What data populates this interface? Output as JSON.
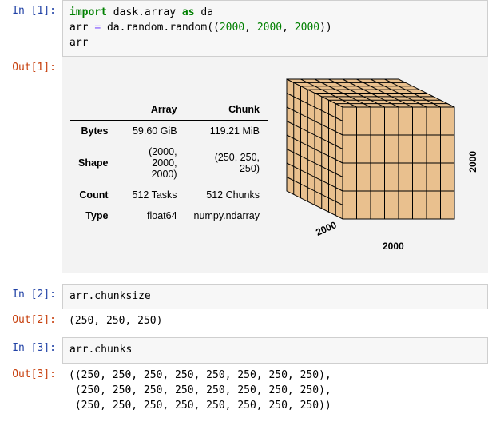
{
  "cells": {
    "in1": {
      "prompt": "In [1]:",
      "code": {
        "kw_import": "import",
        "mod": " dask.array ",
        "kw_as": "as",
        "alias": " da",
        "line2_a": "arr ",
        "line2_eq": "=",
        "line2_b": " da.random.random((",
        "n1": "2000",
        "sep1": ", ",
        "n2": "2000",
        "sep2": ", ",
        "n3": "2000",
        "line2_c": "))",
        "line3": "arr"
      }
    },
    "out1": {
      "prompt": "Out[1]:",
      "table": {
        "col_array": "Array",
        "col_chunk": "Chunk",
        "rows": {
          "bytes": {
            "label": "Bytes",
            "array": "59.60 GiB",
            "chunk": "119.21 MiB"
          },
          "shape": {
            "label": "Shape",
            "array": "(2000, 2000, 2000)",
            "chunk": "(250, 250, 250)"
          },
          "count": {
            "label": "Count",
            "array": "512 Tasks",
            "chunk": "512 Chunks"
          },
          "type": {
            "label": "Type",
            "array": "float64",
            "chunk": "numpy.ndarray"
          }
        }
      },
      "cube": {
        "dim_x": "2000",
        "dim_y": "2000",
        "dim_z": "2000"
      }
    },
    "in2": {
      "prompt": "In [2]:",
      "code": "arr.chunksize"
    },
    "out2": {
      "prompt": "Out[2]:",
      "text": "(250, 250, 250)"
    },
    "in3": {
      "prompt": "In [3]:",
      "code": "arr.chunks"
    },
    "out3": {
      "prompt": "Out[3]:",
      "text": "((250, 250, 250, 250, 250, 250, 250, 250),\n (250, 250, 250, 250, 250, 250, 250, 250),\n (250, 250, 250, 250, 250, 250, 250, 250))"
    }
  },
  "chart_data": {
    "type": "table",
    "title": "Dask array HTML repr",
    "columns": [
      "",
      "Array",
      "Chunk"
    ],
    "rows": [
      [
        "Bytes",
        "59.60 GiB",
        "119.21 MiB"
      ],
      [
        "Shape",
        "(2000, 2000, 2000)",
        "(250, 250, 250)"
      ],
      [
        "Count",
        "512 Tasks",
        "512 Chunks"
      ],
      [
        "Type",
        "float64",
        "numpy.ndarray"
      ]
    ],
    "cube_diagram": {
      "axis_extents": [
        2000,
        2000,
        2000
      ],
      "chunks_per_axis": [
        8,
        8,
        8
      ],
      "face_color": "#e9c08e",
      "edge_color": "#000000"
    }
  }
}
